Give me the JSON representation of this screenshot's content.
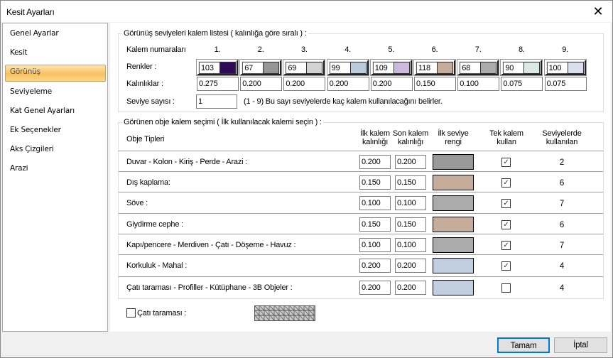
{
  "window": {
    "title": "Kesit Ayarları",
    "close_icon": "close-icon"
  },
  "sidebar": {
    "items": [
      "Genel Ayarlar",
      "Kesit",
      "Görünüş",
      "Seviyeleme",
      "Kat Genel Ayarları",
      "Ek Seçenekler",
      "Aks Çizgileri",
      "Arazi"
    ],
    "active": "Görünüş"
  },
  "levels": {
    "title": "Görünüş seviyeleri kalem listesi ( kalınlığa göre sıralı ) :",
    "pen_numbers_label": "Kalem numaraları",
    "colors_label": "Renkler :",
    "thickness_label": "Kalınlıklar :",
    "level_count_label": "Seviye sayısı :",
    "level_count": "1",
    "level_hint": "(1 - 9) Bu sayı seviyelerde kaç kalem kullanılacağını belirler.",
    "columns": [
      {
        "no": "1.",
        "pen": "103",
        "color": "#2e0b52",
        "thickness": "0.275"
      },
      {
        "no": "2.",
        "pen": "67",
        "color": "#969696",
        "thickness": "0.200"
      },
      {
        "no": "3.",
        "pen": "69",
        "color": "#d2d2d2",
        "thickness": "0.200"
      },
      {
        "no": "4.",
        "pen": "99",
        "color": "#bccbdc",
        "thickness": "0.200"
      },
      {
        "no": "5.",
        "pen": "109",
        "color": "#cbbadb",
        "thickness": "0.200"
      },
      {
        "no": "6.",
        "pen": "118",
        "color": "#c6ac9a",
        "thickness": "0.150"
      },
      {
        "no": "7.",
        "pen": "68",
        "color": "#ababab",
        "thickness": "0.100"
      },
      {
        "no": "8.",
        "pen": "90",
        "color": "#dce9e3",
        "thickness": "0.075"
      },
      {
        "no": "9.",
        "pen": "100",
        "color": "#d9e0eb",
        "thickness": "0.075"
      }
    ]
  },
  "objects": {
    "title": "Görünen obje kalem seçimi ( İlk kullanılacak kalemi seçin ) :",
    "headers": {
      "type": "Obje Tipleri",
      "first1": "İlk kalem",
      "first2": "kalınlığı",
      "last1": "Son kalem",
      "last2": "kalınlığı",
      "color1": "İlk seviye",
      "color2": "rengi",
      "single1": "Tek kalem",
      "single2": "kullan",
      "used1": "Seviyelerde",
      "used2": "kullanılan"
    },
    "rows": [
      {
        "name": "Duvar - Kolon - Kiriş - Perde - Arazi :",
        "first": "0.200",
        "last": "0.200",
        "color": "#999999",
        "single": true,
        "used": "2"
      },
      {
        "name": "Dış kaplama:",
        "first": "0.150",
        "last": "0.150",
        "color": "#c6ac9a",
        "single": true,
        "used": "6"
      },
      {
        "name": "Söve :",
        "first": "0.100",
        "last": "0.100",
        "color": "#ababab",
        "single": true,
        "used": "7"
      },
      {
        "name": "Giydirme cephe :",
        "first": "0.150",
        "last": "0.150",
        "color": "#c6ac9a",
        "single": true,
        "used": "6"
      },
      {
        "name": "Kapı/pencere - Merdiven - Çatı - Döşeme - Havuz :",
        "first": "0.100",
        "last": "0.100",
        "color": "#ababab",
        "single": true,
        "used": "7"
      },
      {
        "name": "Korkuluk - Mahal :",
        "first": "0.200",
        "last": "0.200",
        "color": "#c1cde0",
        "single": true,
        "used": "4"
      },
      {
        "name": "Çatı taraması - Profiller - Kütüphane - 3B Objeler :",
        "first": "0.200",
        "last": "0.200",
        "color": "#c1cde0",
        "single": false,
        "used": "4"
      }
    ]
  },
  "roof_hatch": {
    "label": "Çatı taraması :",
    "checked": false
  },
  "buttons": {
    "ok": "Tamam",
    "cancel": "İptal"
  }
}
